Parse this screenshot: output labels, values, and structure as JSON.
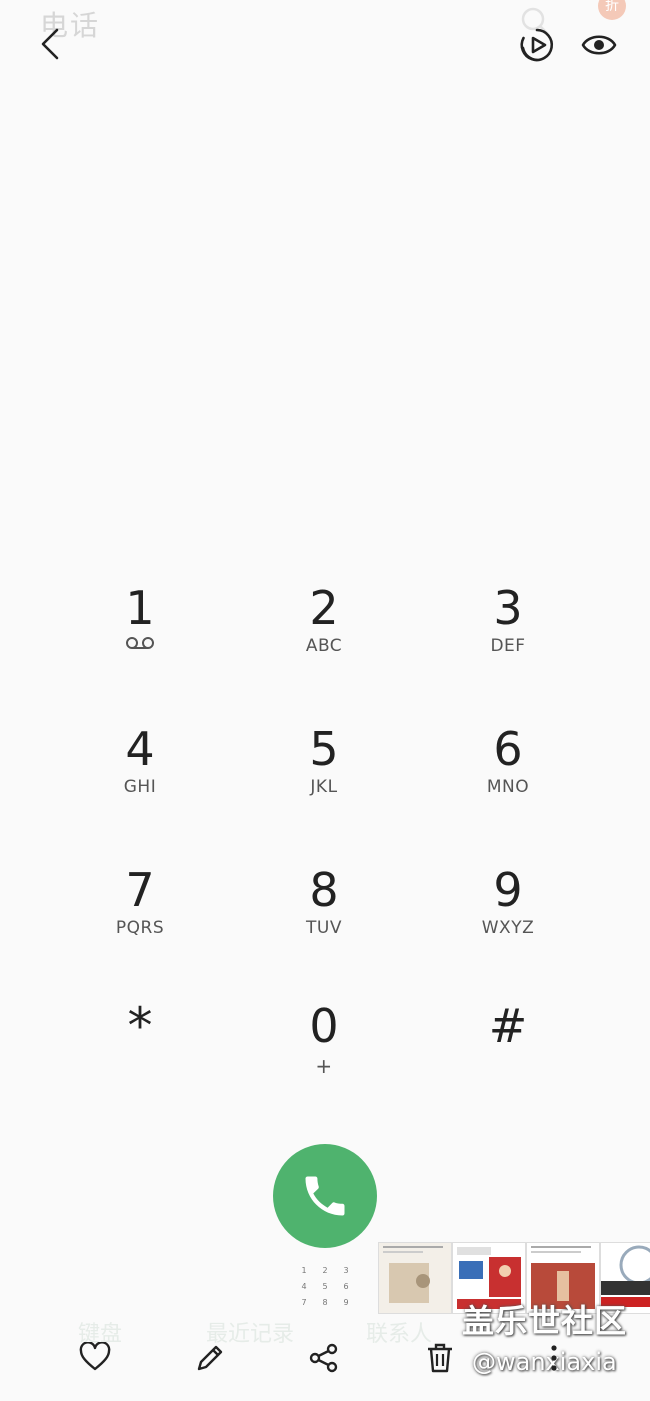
{
  "header": {
    "ghost_title": "电话",
    "ghost_badge": "折"
  },
  "keypad": {
    "keys": [
      {
        "digit": "1",
        "letters": ""
      },
      {
        "digit": "2",
        "letters": "ABC"
      },
      {
        "digit": "3",
        "letters": "DEF"
      },
      {
        "digit": "4",
        "letters": "GHI"
      },
      {
        "digit": "5",
        "letters": "JKL"
      },
      {
        "digit": "6",
        "letters": "MNO"
      },
      {
        "digit": "7",
        "letters": "PQRS"
      },
      {
        "digit": "8",
        "letters": "TUV"
      },
      {
        "digit": "9",
        "letters": "WXYZ"
      },
      {
        "digit": "*",
        "letters": ""
      },
      {
        "digit": "0",
        "letters": "+"
      },
      {
        "digit": "#",
        "letters": ""
      }
    ]
  },
  "mini_keypad": [
    "1",
    "2",
    "3",
    "4",
    "5",
    "6",
    "7",
    "8",
    "9"
  ],
  "ghost_tabs": {
    "keypad": "键盘",
    "recent": "最近记录",
    "contacts": "联系人"
  },
  "watermark": {
    "brand": "盖乐世社区",
    "handle": "@wanxiaxia"
  },
  "colors": {
    "call_green": "#4fb36e",
    "background": "#fafafa",
    "icon": "#222222"
  },
  "icons": {
    "back": "chevron-left-icon",
    "video": "video-call-icon",
    "eye": "eye-icon",
    "voicemail": "voicemail-icon",
    "call": "phone-icon",
    "favorite": "heart-icon",
    "edit": "pencil-icon",
    "share": "share-icon",
    "delete": "trash-icon",
    "more": "more-vertical-icon"
  }
}
